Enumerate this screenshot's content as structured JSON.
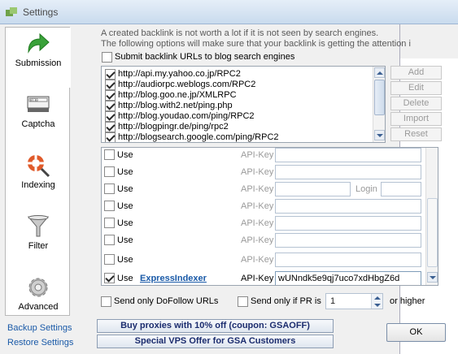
{
  "window": {
    "title": "Settings"
  },
  "sidebar": {
    "items": [
      {
        "label": "Submission",
        "icon": "green-arrow-icon"
      },
      {
        "label": "Captcha",
        "icon": "captcha-icon"
      },
      {
        "label": "Indexing",
        "icon": "lifebuoy-magnifier-icon"
      },
      {
        "label": "Filter",
        "icon": "funnel-icon"
      },
      {
        "label": "Advanced",
        "icon": "gear-icon"
      }
    ]
  },
  "links": {
    "backup": "Backup Settings",
    "restore": "Restore Settings"
  },
  "info": {
    "line1": "A created backlink is not worth a lot if it is not seen by search engines.",
    "line2": "The following options will make sure that your backlink is getting the attention i"
  },
  "submit_blog": {
    "label": "Submit backlink URLs to blog search engines",
    "checked": false
  },
  "ping_list": [
    {
      "url": "http://api.my.yahoo.co.jp/RPC2",
      "checked": true
    },
    {
      "url": "http://audiorpc.weblogs.com/RPC2",
      "checked": true
    },
    {
      "url": "http://blog.goo.ne.jp/XMLRPC",
      "checked": true
    },
    {
      "url": "http://blog.with2.net/ping.php",
      "checked": true
    },
    {
      "url": "http://blog.youdao.com/ping/RPC2",
      "checked": true
    },
    {
      "url": "http://blogpingr.de/ping/rpc2",
      "checked": true
    },
    {
      "url": "http://blogsearch.google.com/ping/RPC2",
      "checked": true
    }
  ],
  "list_buttons": {
    "add": "Add",
    "edit": "Edit",
    "delete": "Delete",
    "import": "Import",
    "reset": "Reset"
  },
  "indexer_rows": [
    {
      "use": "Use",
      "service": "",
      "api_label": "API-Key",
      "api_value": "",
      "checked": false,
      "has_login": false
    },
    {
      "use": "Use",
      "service": "",
      "api_label": "API-Key",
      "api_value": "",
      "checked": false,
      "has_login": false
    },
    {
      "use": "Use",
      "service": "",
      "api_label": "API-Key",
      "api_value": "",
      "checked": false,
      "has_login": true,
      "login_label": "Login"
    },
    {
      "use": "Use",
      "service": "",
      "api_label": "API-Key",
      "api_value": "",
      "checked": false,
      "has_login": false
    },
    {
      "use": "Use",
      "service": "",
      "api_label": "API-Key",
      "api_value": "",
      "checked": false,
      "has_login": false
    },
    {
      "use": "Use",
      "service": "",
      "api_label": "API-Key",
      "api_value": "",
      "checked": false,
      "has_login": false
    },
    {
      "use": "Use",
      "service": "",
      "api_label": "API-Key",
      "api_value": "",
      "checked": false,
      "has_login": false
    },
    {
      "use": "Use",
      "service": "ExpressIndexer",
      "api_label": "API-Key",
      "api_value": "wUNndk5e9qj7uco7xdHbgZ6d",
      "checked": true,
      "has_login": false
    }
  ],
  "options": {
    "dofollow": {
      "label": "Send only DoFollow URLs",
      "checked": false
    },
    "pr": {
      "label": "Send only if PR is",
      "checked": false,
      "value": "1",
      "suffix": "or higher"
    }
  },
  "banners": {
    "proxies": "Buy proxies with 10% off  (coupon: GSAOFF)",
    "vps": "Special VPS Offer for GSA Customers"
  },
  "ok_label": "OK"
}
